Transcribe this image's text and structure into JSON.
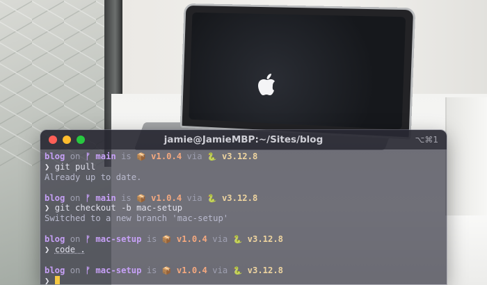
{
  "window": {
    "title": "jamie@JamieMBP:~/Sites/blog",
    "shortcut": "⌥⌘1"
  },
  "prompt_words": {
    "on": "on",
    "is": "is",
    "via": "via",
    "branch_glyph": "ᚠ",
    "package_glyph": "📦",
    "python_glyph": "🐍",
    "arrow": "❯"
  },
  "prompts": [
    {
      "dir": "blog",
      "branch": "main",
      "pkg_version": "v1.0.4",
      "py_version": "v3.12.8"
    },
    {
      "dir": "blog",
      "branch": "main",
      "pkg_version": "v1.0.4",
      "py_version": "v3.12.8"
    },
    {
      "dir": "blog",
      "branch": "mac-setup",
      "pkg_version": "v1.0.4",
      "py_version": "v3.12.8"
    },
    {
      "dir": "blog",
      "branch": "mac-setup",
      "pkg_version": "v1.0.4",
      "py_version": "v3.12.8"
    }
  ],
  "commands": [
    {
      "text": "git pull",
      "output": "Already up to date."
    },
    {
      "text": "git checkout -b mac-setup",
      "output": "Switched to a new branch 'mac-setup'"
    },
    {
      "text": "code .",
      "output": ""
    }
  ],
  "colors": {
    "accent_purple": "#c6a0f6",
    "version_orange": "#f5a97f",
    "python_yellow": "#eed49f",
    "cursor": "#f5c842"
  }
}
